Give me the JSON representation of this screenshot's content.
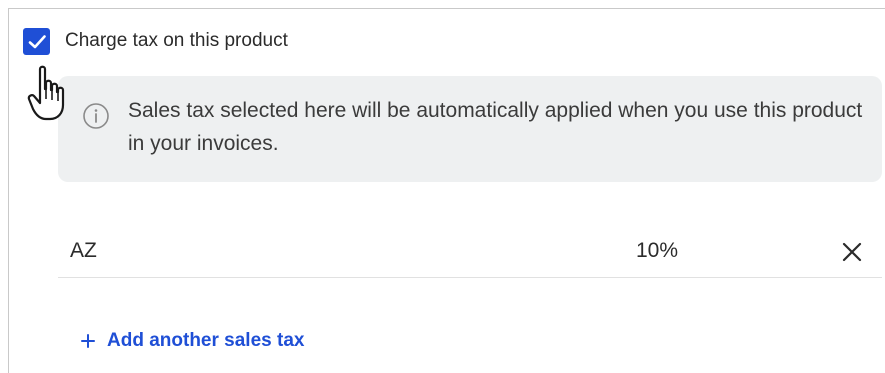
{
  "tax_settings": {
    "charge_tax_label": "Charge tax on this product",
    "charge_tax_checked": true,
    "info_message": "Sales tax selected here will be automatically applied when you use this product in your invoices.",
    "info_icon": "info-circle-icon",
    "taxes": [
      {
        "name": "AZ",
        "rate": "10%",
        "remove_icon": "close-icon"
      }
    ],
    "add_tax_label": "Add another sales tax",
    "add_tax_icon": "plus-icon"
  },
  "colors": {
    "accent": "#1f4fd6",
    "info_background": "#eef0f1",
    "text": "#2b2b2b",
    "divider": "#e1e1e1"
  }
}
